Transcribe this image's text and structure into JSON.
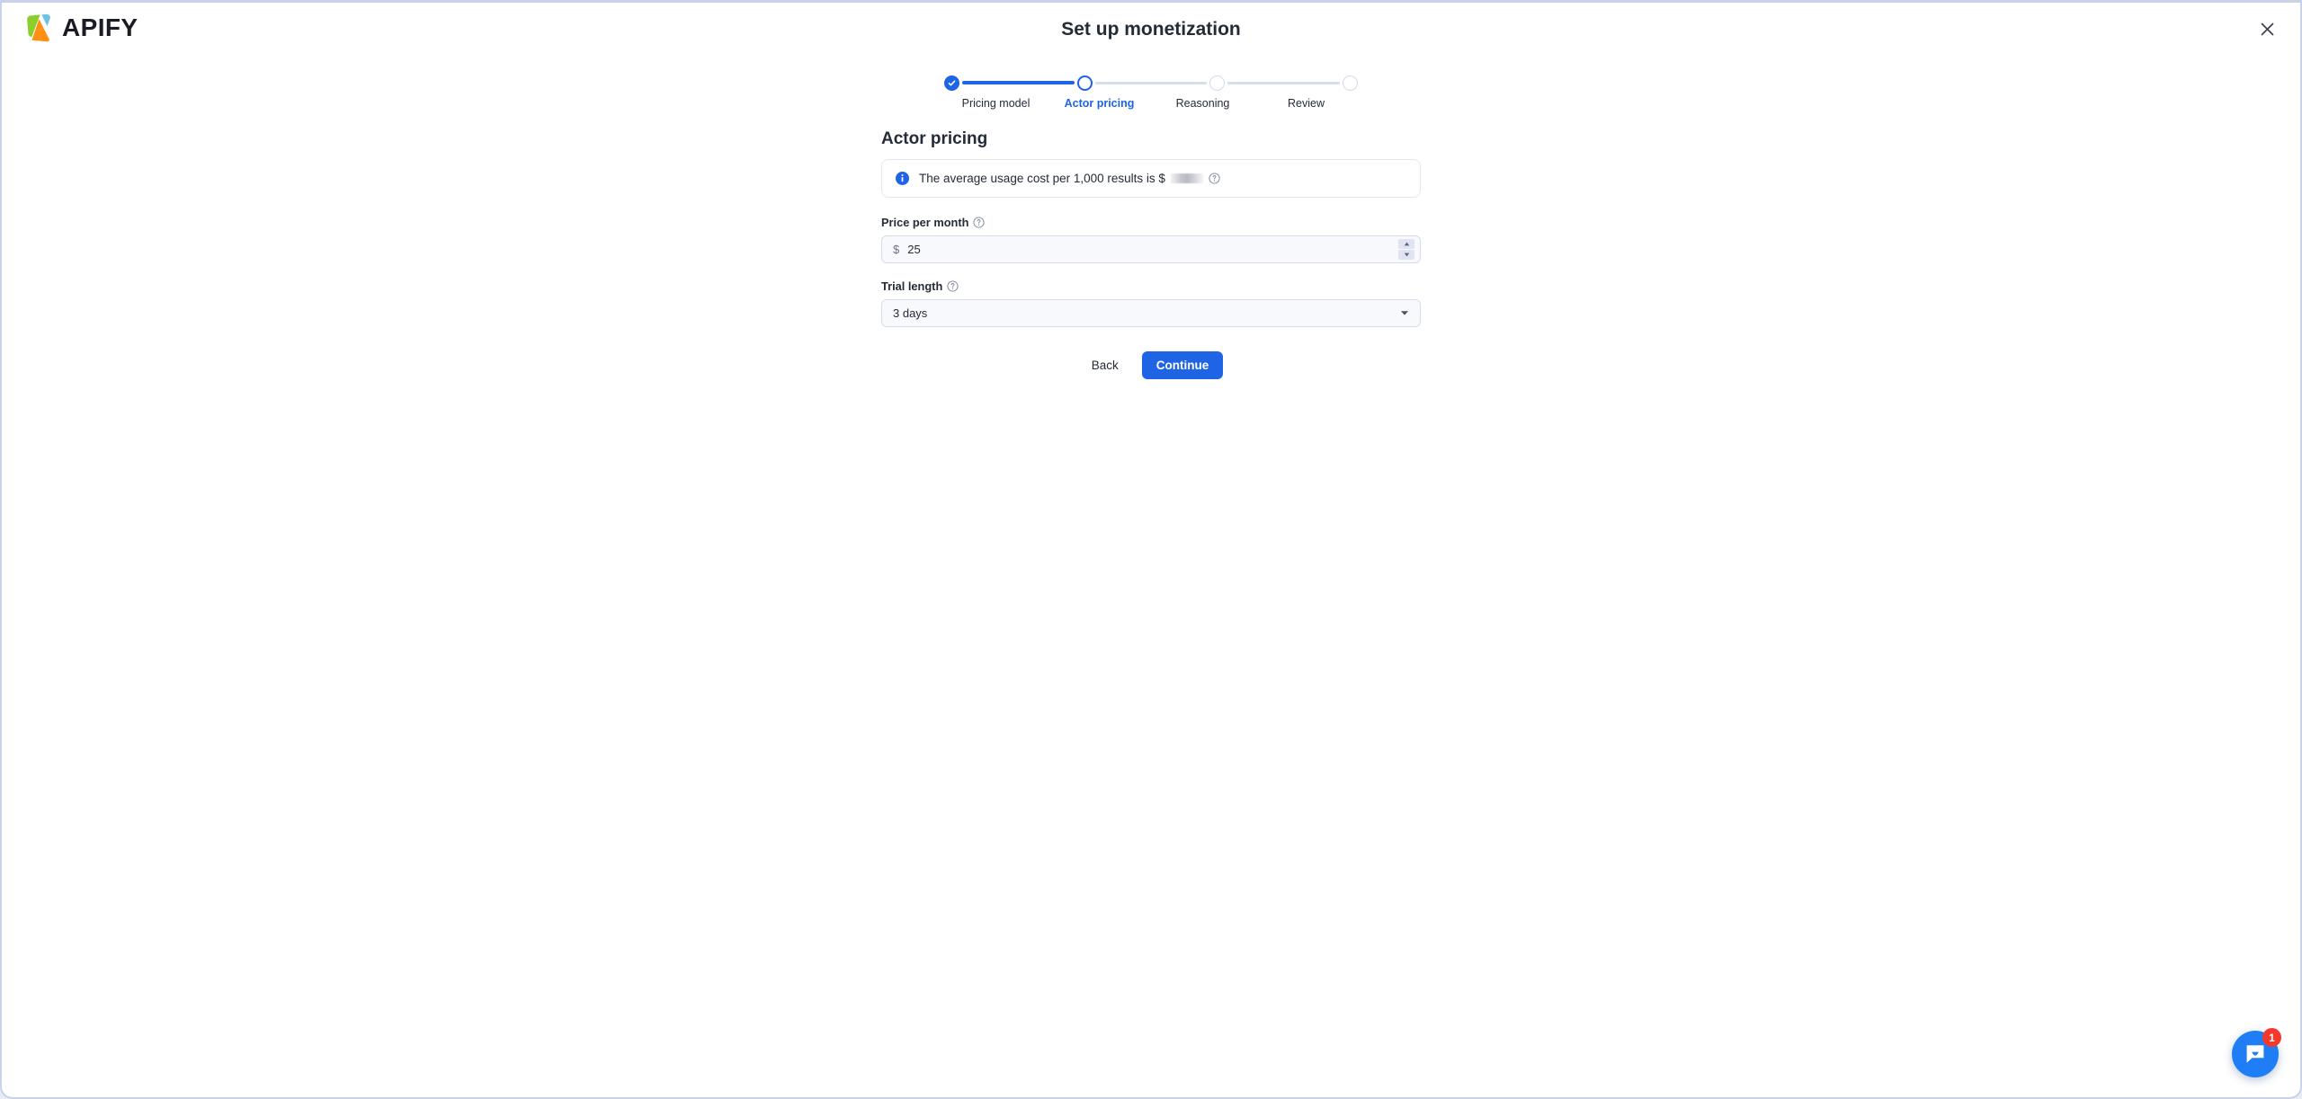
{
  "brand": {
    "name": "APIFY",
    "logo_icon": "apify-logo-icon",
    "colors": {
      "green": "#8ACF2B",
      "blue": "#6EC2E8",
      "orange": "#FF9013",
      "accent": "#1F64E5",
      "badge_red": "#F5382C"
    }
  },
  "header": {
    "title": "Set up monetization",
    "close_icon": "close-icon"
  },
  "stepper": {
    "steps": [
      {
        "label": "Pricing model",
        "state": "done"
      },
      {
        "label": "Actor pricing",
        "state": "active"
      },
      {
        "label": "Reasoning",
        "state": "todo"
      },
      {
        "label": "Review",
        "state": "todo"
      }
    ]
  },
  "main": {
    "section_title": "Actor pricing",
    "alert": {
      "icon": "info-icon",
      "text_before": "The average usage cost per 1,000 results is $",
      "redacted_value": "",
      "help_icon": "help-circle-icon"
    },
    "fields": [
      {
        "label": "Price per month",
        "help_icon": "help-circle-icon",
        "currency": "$",
        "value": "25",
        "placeholder": "",
        "increment_icon": "caret-up-icon",
        "decrement_icon": "caret-down-icon"
      },
      {
        "label": "Trial length",
        "help_icon": "help-circle-icon",
        "value": "3 days",
        "chevron_icon": "chevron-down-icon"
      }
    ]
  },
  "actions": {
    "back_label": "Back",
    "continue_label": "Continue"
  },
  "chat": {
    "icon": "chat-bubble-icon",
    "badge_count": "1"
  }
}
